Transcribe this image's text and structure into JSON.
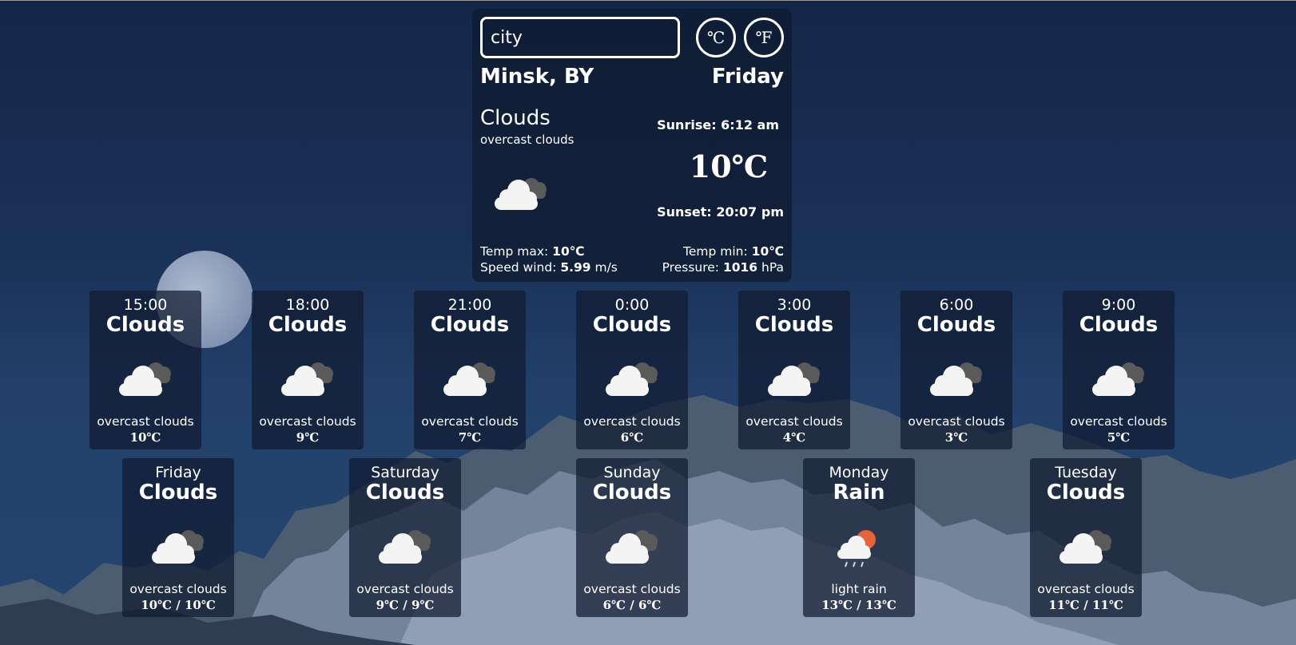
{
  "search": {
    "placeholder": "city"
  },
  "units": {
    "celsius": "℃",
    "fahrenheit": "℉"
  },
  "current": {
    "location": "Minsk, BY",
    "day": "Friday",
    "condition": "Clouds",
    "description": "overcast clouds",
    "icon": "overcast-clouds-icon",
    "sunrise": "Sunrise: 6:12 am",
    "temp": "10℃",
    "sunset": "Sunset: 20:07 pm",
    "temp_max_label": "Temp max: ",
    "temp_max": "10℃",
    "temp_min_label": "Temp min: ",
    "temp_min": "10℃",
    "wind_label": "Speed wind: ",
    "wind": "5.99",
    "wind_unit": " m/s",
    "pressure_label": "Pressure: ",
    "pressure": "1016",
    "pressure_unit": " hPa"
  },
  "hourly": [
    {
      "time": "15:00",
      "condition": "Clouds",
      "description": "overcast clouds",
      "temp": "10℃",
      "icon": "overcast-clouds-icon"
    },
    {
      "time": "18:00",
      "condition": "Clouds",
      "description": "overcast clouds",
      "temp": "9℃",
      "icon": "overcast-clouds-icon"
    },
    {
      "time": "21:00",
      "condition": "Clouds",
      "description": "overcast clouds",
      "temp": "7℃",
      "icon": "overcast-clouds-icon"
    },
    {
      "time": "0:00",
      "condition": "Clouds",
      "description": "overcast clouds",
      "temp": "6℃",
      "icon": "overcast-clouds-icon"
    },
    {
      "time": "3:00",
      "condition": "Clouds",
      "description": "overcast clouds",
      "temp": "4℃",
      "icon": "overcast-clouds-icon"
    },
    {
      "time": "6:00",
      "condition": "Clouds",
      "description": "overcast clouds",
      "temp": "3℃",
      "icon": "overcast-clouds-icon"
    },
    {
      "time": "9:00",
      "condition": "Clouds",
      "description": "overcast clouds",
      "temp": "5℃",
      "icon": "overcast-clouds-icon"
    }
  ],
  "daily": [
    {
      "day": "Friday",
      "condition": "Clouds",
      "description": "overcast clouds",
      "temp": "10℃ / 10℃",
      "icon": "overcast-clouds-icon"
    },
    {
      "day": "Saturday",
      "condition": "Clouds",
      "description": "overcast clouds",
      "temp": "9℃ / 9℃",
      "icon": "overcast-clouds-icon"
    },
    {
      "day": "Sunday",
      "condition": "Clouds",
      "description": "overcast clouds",
      "temp": "6℃ / 6℃",
      "icon": "overcast-clouds-icon"
    },
    {
      "day": "Monday",
      "condition": "Rain",
      "description": "light rain",
      "temp": "13℃ / 13℃",
      "icon": "light-rain-icon"
    },
    {
      "day": "Tuesday",
      "condition": "Clouds",
      "description": "overcast clouds",
      "temp": "11℃ / 11℃",
      "icon": "overcast-clouds-icon"
    }
  ],
  "colors": {
    "card_bg": "#101b31",
    "sun": "#e8623a",
    "cloud": "#f4f4f4",
    "cloud_dark": "#5a5a5a"
  }
}
